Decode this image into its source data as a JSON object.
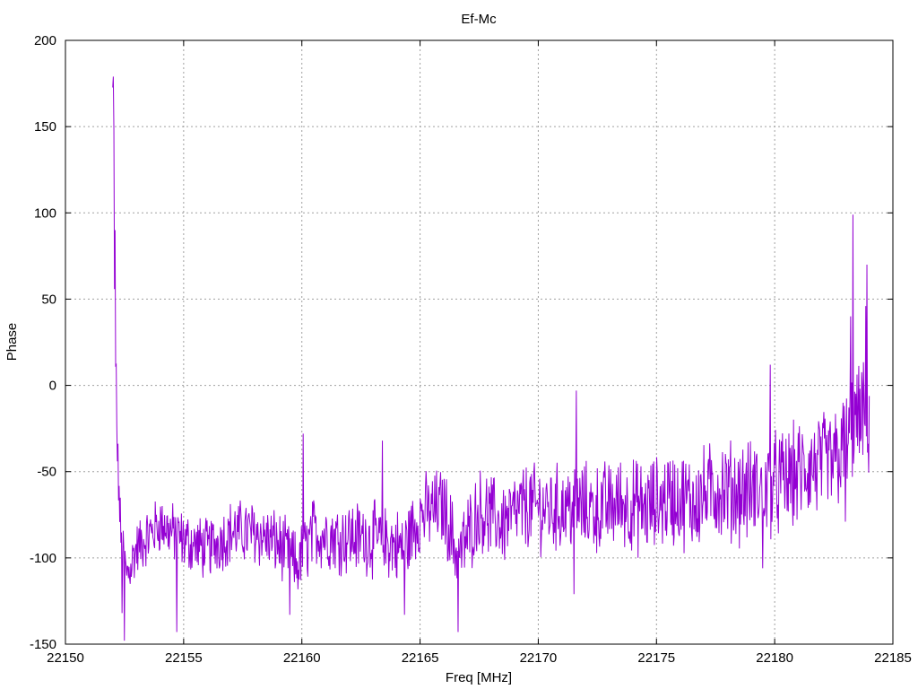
{
  "chart_data": {
    "type": "line",
    "title": "Ef-Mc",
    "xlabel": "Freq [MHz]",
    "ylabel": "Phase",
    "xlim": [
      22150,
      22185
    ],
    "ylim": [
      -150,
      200
    ],
    "xticks": [
      22150,
      22155,
      22160,
      22165,
      22170,
      22175,
      22180,
      22185
    ],
    "yticks": [
      -150,
      -100,
      -50,
      0,
      50,
      100,
      150,
      200
    ],
    "grid": true,
    "legend": "none",
    "series": [
      {
        "color": "#9400d3",
        "x_range": [
          22152.0,
          22184.0
        ],
        "points_count": 1300,
        "anchor_x": [
          22152.0,
          22152.05,
          22152.1,
          22152.2,
          22152.35,
          22152.6,
          22153.0,
          22154.0,
          22155.0,
          22156.0,
          22157.0,
          22158.0,
          22159.0,
          22159.8,
          22160.5,
          22161.5,
          22162.5,
          22163.5,
          22164.3,
          22165.0,
          22166.0,
          22166.6,
          22167.5,
          22168.5,
          22169.5,
          22170.5,
          22171.5,
          22172.5,
          22173.5,
          22174.5,
          22175.5,
          22176.5,
          22177.5,
          22178.5,
          22179.5,
          22180.5,
          22181.5,
          22182.5,
          22183.0,
          22183.5,
          22184.0
        ],
        "anchor_y": [
          170,
          100,
          20,
          -40,
          -90,
          -110,
          -95,
          -80,
          -90,
          -95,
          -85,
          -85,
          -92,
          -105,
          -85,
          -88,
          -88,
          -90,
          -95,
          -75,
          -70,
          -100,
          -72,
          -80,
          -70,
          -72,
          -70,
          -72,
          -68,
          -72,
          -65,
          -68,
          -60,
          -62,
          -60,
          -55,
          -48,
          -45,
          -35,
          -20,
          -20
        ],
        "spikes": [
          {
            "x": 22152.02,
            "y": 179
          },
          {
            "x": 22152.06,
            "y": 148
          },
          {
            "x": 22152.1,
            "y": 90
          },
          {
            "x": 22152.15,
            "y": 12
          },
          {
            "x": 22152.5,
            "y": -148
          },
          {
            "x": 22152.4,
            "y": -132
          },
          {
            "x": 22154.7,
            "y": -143
          },
          {
            "x": 22159.5,
            "y": -133
          },
          {
            "x": 22160.05,
            "y": -28
          },
          {
            "x": 22163.4,
            "y": -32
          },
          {
            "x": 22164.35,
            "y": -133
          },
          {
            "x": 22166.6,
            "y": -143
          },
          {
            "x": 22171.5,
            "y": -121
          },
          {
            "x": 22171.6,
            "y": -3
          },
          {
            "x": 22179.5,
            "y": -106
          },
          {
            "x": 22179.8,
            "y": 12
          },
          {
            "x": 22183.3,
            "y": 99
          },
          {
            "x": 22183.2,
            "y": 40
          },
          {
            "x": 22183.9,
            "y": 70
          },
          {
            "x": 22183.85,
            "y": 46
          },
          {
            "x": 22183.0,
            "y": -79
          }
        ]
      }
    ]
  }
}
